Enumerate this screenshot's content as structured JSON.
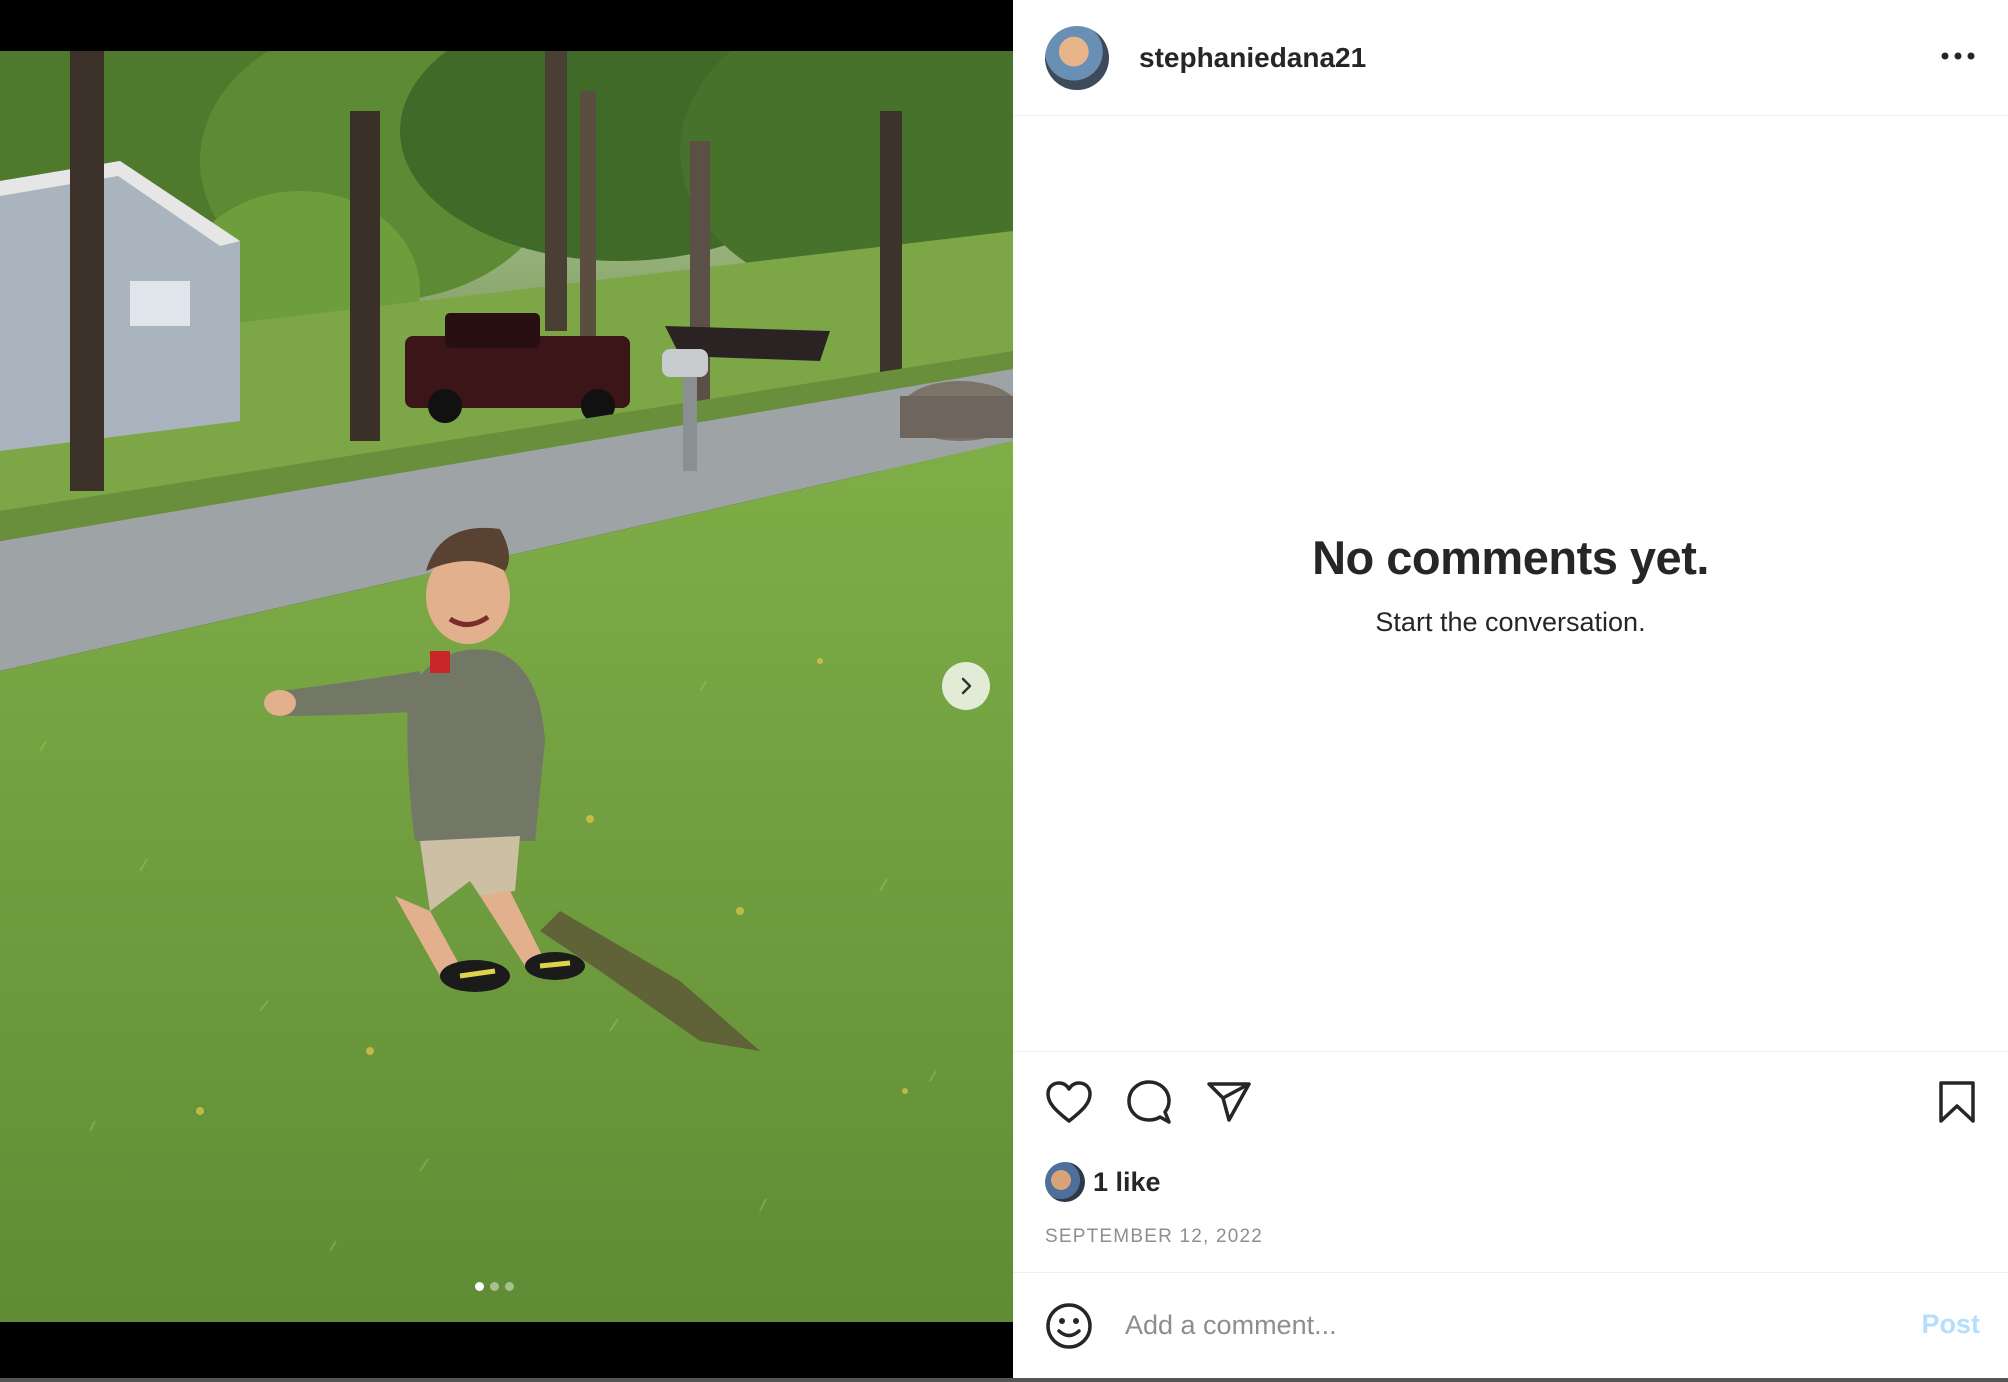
{
  "post": {
    "username": "stephaniedana21",
    "more_icon": "more-horizontal-icon",
    "media_alt": "Photo of a smiling boy in a camo hoodie playing on a grassy lawn near a street with trees, a pickup truck and a boat",
    "carousel": {
      "total": 3,
      "current": 1
    }
  },
  "comments": {
    "empty_title": "No comments yet.",
    "empty_subtitle": "Start the conversation."
  },
  "actions": {
    "like_icon": "heart-icon",
    "comment_icon": "comment-bubble-icon",
    "share_icon": "paper-plane-icon",
    "save_icon": "bookmark-icon"
  },
  "likes": {
    "label": "1 like"
  },
  "date": "SEPTEMBER 12, 2022",
  "comment_box": {
    "placeholder": "Add a comment...",
    "post_label": "Post",
    "post_color": "#b2dffc"
  }
}
